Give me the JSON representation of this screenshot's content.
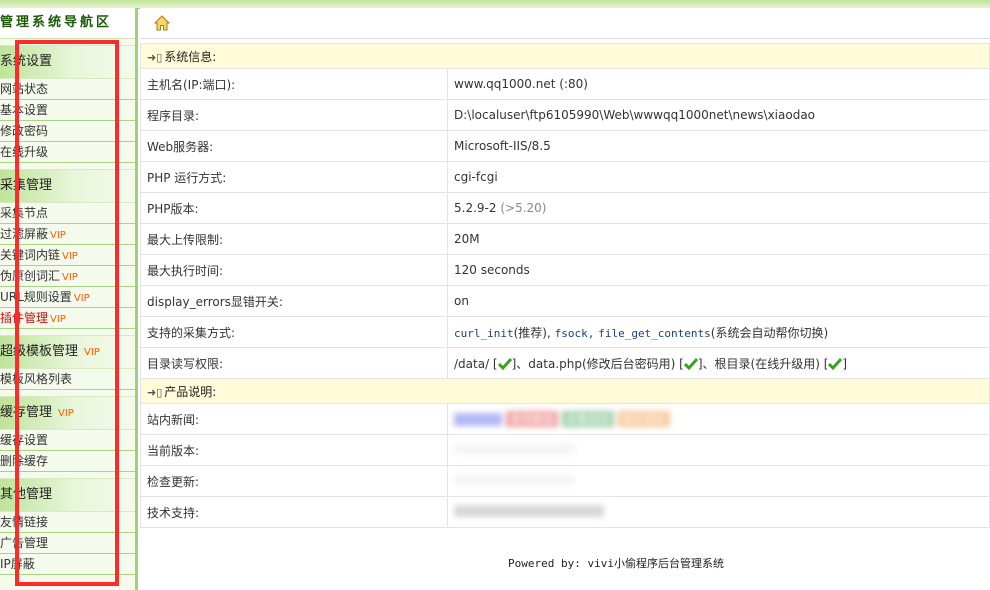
{
  "sidebar": {
    "title": "管理系统导航区",
    "groups": [
      {
        "title": "系统设置",
        "vip": "",
        "items": [
          {
            "label": "网站状态",
            "vip": ""
          },
          {
            "label": "基本设置",
            "vip": ""
          },
          {
            "label": "修改密码",
            "vip": ""
          },
          {
            "label": "在线升级",
            "vip": ""
          }
        ]
      },
      {
        "title": "采集管理",
        "vip": "",
        "items": [
          {
            "label": "采集节点",
            "vip": ""
          },
          {
            "label": "过滤屏蔽",
            "vip": "VIP"
          },
          {
            "label": "关键词内链",
            "vip": "VIP"
          },
          {
            "label": "伪原创词汇",
            "vip": "VIP"
          },
          {
            "label": "URL规则设置",
            "vip": "VIP"
          },
          {
            "label": "插件管理",
            "vip": "VIP"
          }
        ]
      },
      {
        "title": "超级模板管理",
        "vip": "VIP",
        "items": [
          {
            "label": "模板风格列表",
            "vip": ""
          }
        ]
      },
      {
        "title": "缓存管理",
        "vip": "VIP",
        "items": [
          {
            "label": "缓存设置",
            "vip": ""
          },
          {
            "label": "删除缓存",
            "vip": ""
          }
        ]
      },
      {
        "title": "其他管理",
        "vip": "",
        "items": [
          {
            "label": "友情链接",
            "vip": ""
          },
          {
            "label": "广告管理",
            "vip": ""
          },
          {
            "label": "IP屏蔽",
            "vip": ""
          }
        ]
      }
    ]
  },
  "sections": {
    "system_info": {
      "title": "系统信息:",
      "rows": [
        {
          "label": "主机名(IP:端口):",
          "value": "www.qq1000.net",
          "extra": "(:80)"
        },
        {
          "label": "程序目录:",
          "value": "D:\\localuser\\ftp6105990\\Web\\wwwqq1000net\\news\\xiaodao"
        },
        {
          "label": "Web服务器:",
          "value": "Microsoft-IIS/8.5"
        },
        {
          "label": "PHP 运行方式:",
          "value": "cgi-fcgi"
        },
        {
          "label": "PHP版本:",
          "value": "5.2.9-2",
          "extra": "(>5.20)"
        },
        {
          "label": "最大上传限制:",
          "value": "20M"
        },
        {
          "label": "最大执行时间:",
          "value": "120 seconds"
        },
        {
          "label": "display_errors显错开关:",
          "value": "on"
        }
      ],
      "collect": {
        "label": "支持的采集方式:",
        "curl": "curl_init",
        "curl_note": "(推荐),",
        "fsock": "fsock,",
        "fgc": "file_get_contents",
        "note": "(系统会自动帮你切换)"
      },
      "perm": {
        "label": "目录读写权限:",
        "part1": "/data/ [",
        "part2": "]、data.php(修改后台密码用) [",
        "part3": "]、根目录(在线升级用) [",
        "part4": "]"
      }
    },
    "product": {
      "title": "产品说明:",
      "rows": [
        {
          "label": "站内新闻:",
          "tags": [
            "使用教程",
            "采集规则",
            "购买授权"
          ]
        },
        {
          "label": "当前版本:"
        },
        {
          "label": "检查更新:"
        },
        {
          "label": "技术支持:"
        }
      ]
    }
  },
  "footer": {
    "powered": "Powered by:",
    "name": "vivi小偷程序后台管理系统"
  },
  "colors": {
    "accent": "#9fd17a",
    "vip": "#ff5a00",
    "highlight": "#ff2b2b",
    "check": "#3aa21a"
  }
}
